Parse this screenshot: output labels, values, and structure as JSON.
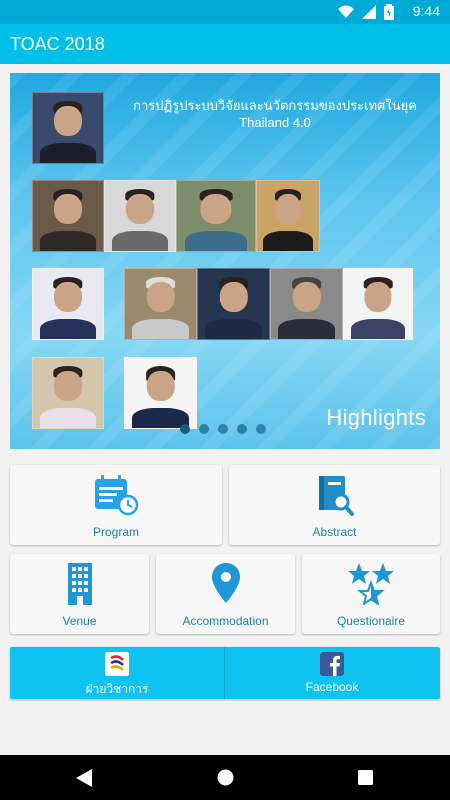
{
  "status_bar": {
    "time": "9:44"
  },
  "app_bar": {
    "title": "TOAC 2018"
  },
  "banner": {
    "headline_line1": "การปฏิรูประบบวิจัยและนวัตกรรมของประเทศในยุค",
    "headline_line2": "Thailand 4.0",
    "highlights_label": "Highlights",
    "carousel_page": 1,
    "carousel_total": 5
  },
  "tiles": {
    "program": "Program",
    "abstract": "Abstract",
    "venue": "Venue",
    "accommodation": "Accommodation",
    "questionaire": "Questionaire"
  },
  "bottom": {
    "academic": "ฝ่ายวิชาการ",
    "facebook": "Facebook"
  },
  "colors": {
    "status_bar": "#00a8d6",
    "app_bar": "#00bfe9",
    "accent_blue": "#1a7fb5",
    "bottom_bar": "#0ec3ef"
  }
}
